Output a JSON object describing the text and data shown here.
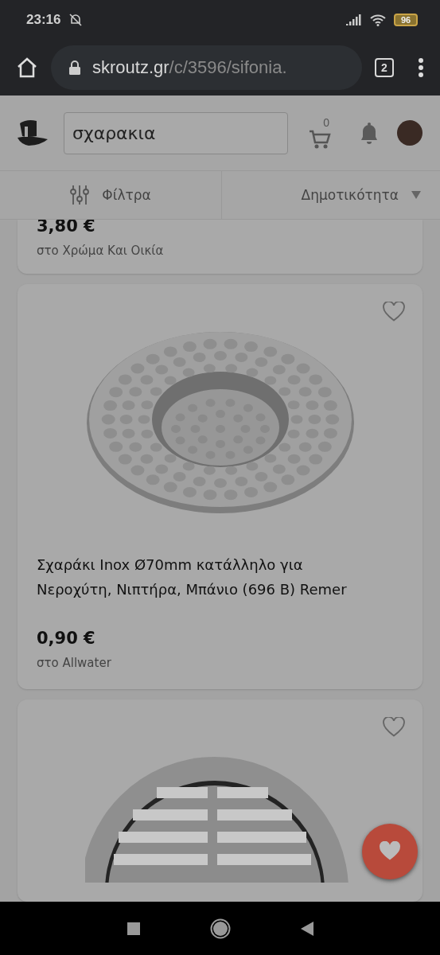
{
  "status_bar": {
    "time": "23:16",
    "battery": "96"
  },
  "browser": {
    "url_host": "skroutz.gr",
    "url_path": "/c/3596/sifonia.",
    "tab_count": "2"
  },
  "header": {
    "search_value": "σχαρακια",
    "cart_count": "0"
  },
  "toolbar": {
    "filters_label": "Φίλτρα",
    "sort_label": "Δημοτικότητα"
  },
  "products": [
    {
      "kind": "partial",
      "price": "3,80 €",
      "store": "στο Χρώμα Και Οικία"
    },
    {
      "kind": "full",
      "favorite": false,
      "title": "Σχαράκι Inox Ø70mm κατάλληλο για Νεροχύτη, Νιπτήρα, Μπάνιο (696 B) Remer",
      "price": "0,90 €",
      "store": "στο Allwater"
    },
    {
      "kind": "cut",
      "favorite": false
    }
  ]
}
